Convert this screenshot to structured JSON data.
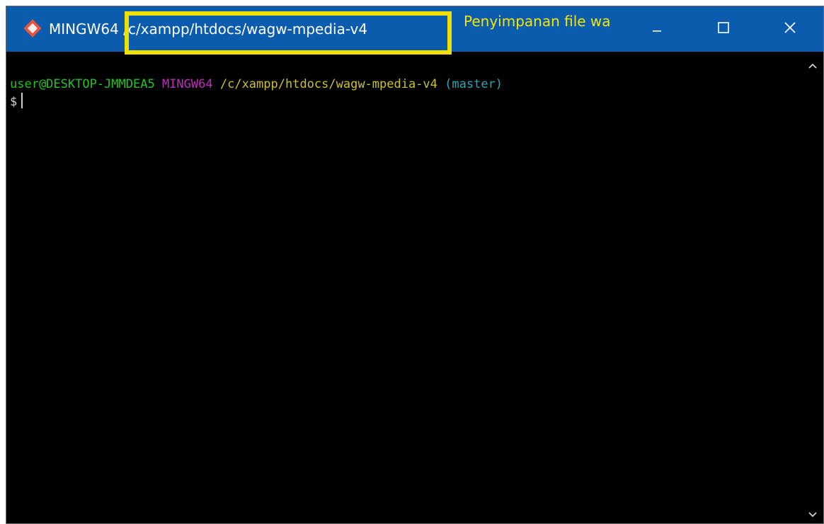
{
  "window": {
    "title_prefix": "MINGW64 ",
    "title_path": "/c/xampp/htdocs/wagw-mpedia-v4",
    "annotation_text": "Penyimpanan file wa",
    "highlight_color": "#f0e000",
    "titlebar_color": "#0b5cad",
    "controls": {
      "minimize_icon": "minimize-icon",
      "maximize_icon": "maximize-icon",
      "close_icon": "close-icon"
    }
  },
  "terminal": {
    "user_host": "user@DESKTOP-JMMDEA5",
    "shell": "MINGW64",
    "cwd": "/c/xampp/htdocs/wagw-mpedia-v4",
    "branch": "(master)",
    "prompt_symbol": "$",
    "colors": {
      "user_host": "#22c322",
      "shell": "#c02ac0",
      "cwd": "#c9c22a",
      "branch": "#2aa6b8",
      "prompt": "#d0d0d0"
    }
  }
}
